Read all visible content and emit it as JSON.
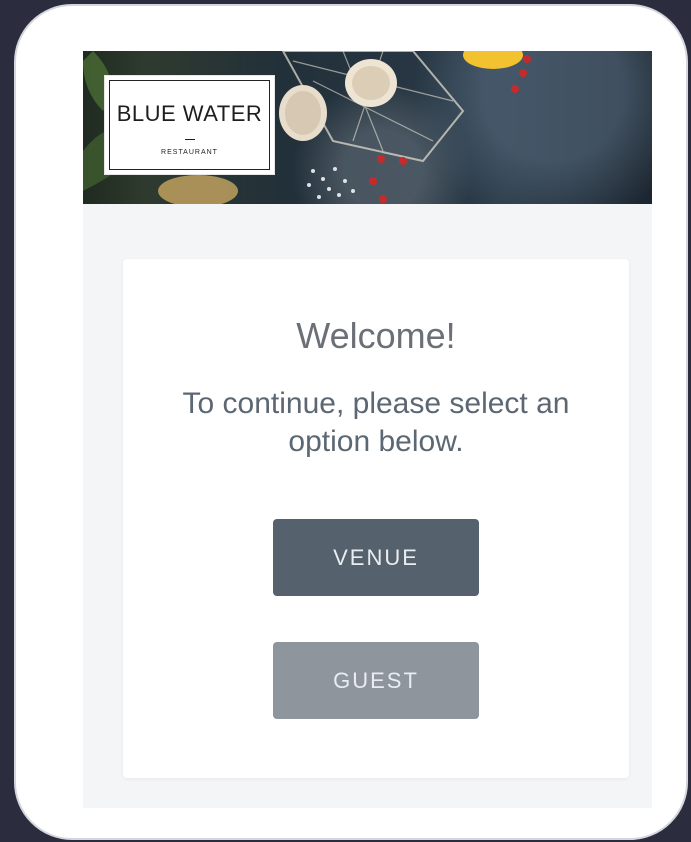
{
  "logo": {
    "title": "BLUE WATER",
    "subtitle": "RESTAURANT"
  },
  "card": {
    "heading": "Welcome!",
    "instruction": "To continue, please select an option below."
  },
  "buttons": {
    "venue_label": "VENUE",
    "guest_label": "GUEST"
  },
  "colors": {
    "background": "#2b2c3d",
    "venue_button": "#55616c",
    "guest_button": "#8f959c",
    "heading_text": "#6b7076"
  }
}
